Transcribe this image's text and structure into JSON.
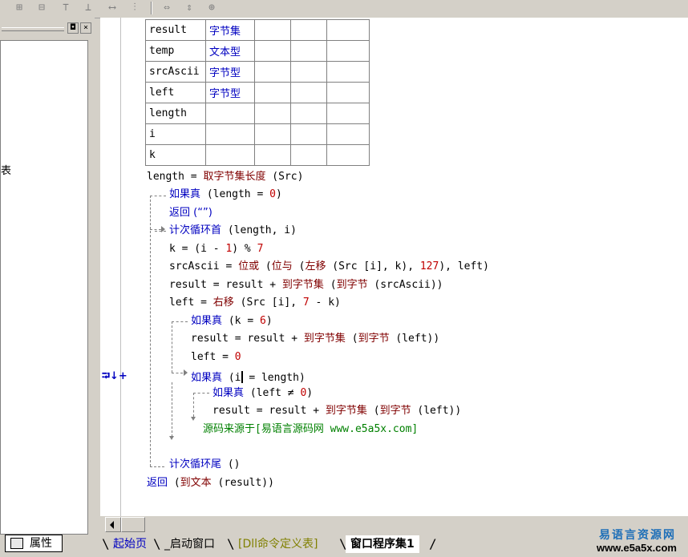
{
  "toolbar": {
    "icons": [
      "insert-row-icon",
      "delete-row-icon",
      "align-top-icon",
      "align-middle-icon",
      "same-width-icon",
      "same-height-icon",
      "expand-h-icon",
      "expand-v-icon",
      "center-icon"
    ]
  },
  "left_panel": {
    "partial_text": "表",
    "restore_glyph": "◘",
    "close_glyph": "×",
    "properties_label": "属性"
  },
  "var_table": {
    "rows": [
      {
        "name": "result",
        "type": "字节集"
      },
      {
        "name": "temp",
        "type": "文本型"
      },
      {
        "name": "srcAscii",
        "type": "字节型"
      },
      {
        "name": "left",
        "type": "字节型"
      },
      {
        "name": "length",
        "type": ""
      },
      {
        "name": "i",
        "type": ""
      },
      {
        "name": "k",
        "type": ""
      }
    ]
  },
  "code": {
    "l1_a": "length = ",
    "l1_fn": "取字节集长度",
    "l1_b": " (Src)",
    "l2_kw": "如果真",
    "l2_a": " (length = ",
    "l2_num": "0",
    "l2_b": ")",
    "l3_kw": "返回",
    "l3_a": " (“”)",
    "l4_kw": "计次循环首",
    "l4_a": " (length, i)",
    "l5_a": "k = (i - ",
    "l5_n1": "1",
    "l5_b": ") % ",
    "l5_n2": "7",
    "l6_a": "srcAscii = ",
    "l6_f1": "位或",
    "l6_b": " (",
    "l6_f2": "位与",
    "l6_c": " (",
    "l6_f3": "左移",
    "l6_d": " (Src [i], k), ",
    "l6_n": "127",
    "l6_e": "), left)",
    "l7_a": "result = result + ",
    "l7_f1": "到字节集",
    "l7_b": " (",
    "l7_f2": "到字节",
    "l7_c": " (srcAscii))",
    "l8_a": "left = ",
    "l8_f": "右移",
    "l8_b": " (Src [i], ",
    "l8_n": "7",
    "l8_c": " - k)",
    "l9_kw": "如果真",
    "l9_a": " (k = ",
    "l9_n": "6",
    "l9_b": ")",
    "l10_a": "result = result + ",
    "l10_f1": "到字节集",
    "l10_b": " (",
    "l10_f2": "到字节",
    "l10_c": " (left))",
    "l11_a": "left = ",
    "l11_n": "0",
    "l12_kw": "如果真",
    "l12_a": " (i",
    "l12_b": " = length)",
    "l13_kw": "如果真",
    "l13_a": " (left ≠ ",
    "l13_n": "0",
    "l13_b": ")",
    "l14_a": "result = result + ",
    "l14_f1": "到字节集",
    "l14_b": " (",
    "l14_f2": "到字节",
    "l14_c": " (left))",
    "l15_comment": "源码来源于[易语言源码网 www.e5a5x.com]",
    "l16_kw": "计次循环尾",
    "l16_a": " ()",
    "l17_kw": "返回",
    "l17_b": " (",
    "l17_fn": "到文本",
    "l17_c": " (result))"
  },
  "gutter_marker": "⮒↓+",
  "tabs": [
    "起始页",
    "_启动窗口",
    "[Dll命令定义表]",
    "窗口程序集1"
  ],
  "brand": {
    "name": "易语言资源网",
    "url": "www.e5a5x.com"
  },
  "colors": {
    "keyword": "#0000c0",
    "function": "#800000",
    "number": "#c00000",
    "comment": "#008000",
    "brand": "#1e6fb8"
  }
}
